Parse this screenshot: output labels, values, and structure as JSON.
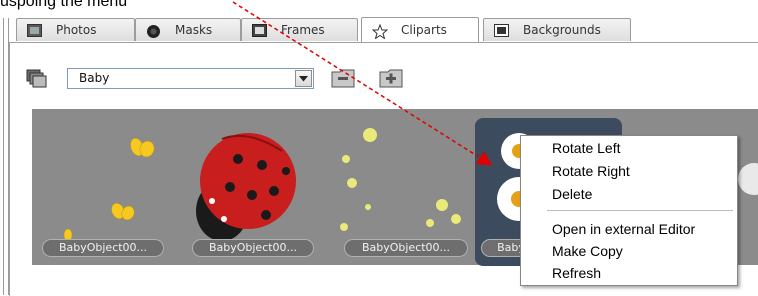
{
  "heading": {
    "text": "uspoing the menu"
  },
  "tabs": [
    {
      "label": "Photos",
      "icon": "photos-icon"
    },
    {
      "label": "Masks",
      "icon": "masks-icon"
    },
    {
      "label": "Frames",
      "icon": "frames-icon"
    },
    {
      "label": "Cliparts",
      "icon": "star-icon",
      "active": true
    },
    {
      "label": "Backgrounds",
      "icon": "backgrounds-icon"
    }
  ],
  "toolbar": {
    "category_select_value": "Baby",
    "remove_category_icon": "folder-minus-icon",
    "add_category_icon": "folder-plus-icon"
  },
  "gallery": {
    "items": [
      {
        "caption": "BabyObject00...",
        "icon": "butterflies-clipart"
      },
      {
        "caption": "BabyObject00...",
        "icon": "ladybug-clipart"
      },
      {
        "caption": "BabyObject00...",
        "icon": "flowers-clipart"
      },
      {
        "caption": "Baby",
        "icon": "daisies-clipart",
        "selected": true
      }
    ]
  },
  "context_menu": {
    "items": [
      {
        "label": "Rotate Left"
      },
      {
        "label": "Rotate Right"
      },
      {
        "label": "Delete"
      },
      {
        "label": "Open in external Editor"
      },
      {
        "label": "Make Copy"
      },
      {
        "label": "Refresh"
      }
    ]
  },
  "colors": {
    "gallery_bg": "#8b8b8b",
    "selected_item_bg": "#3c4b5e",
    "annotation_arrow": "#e00000"
  }
}
